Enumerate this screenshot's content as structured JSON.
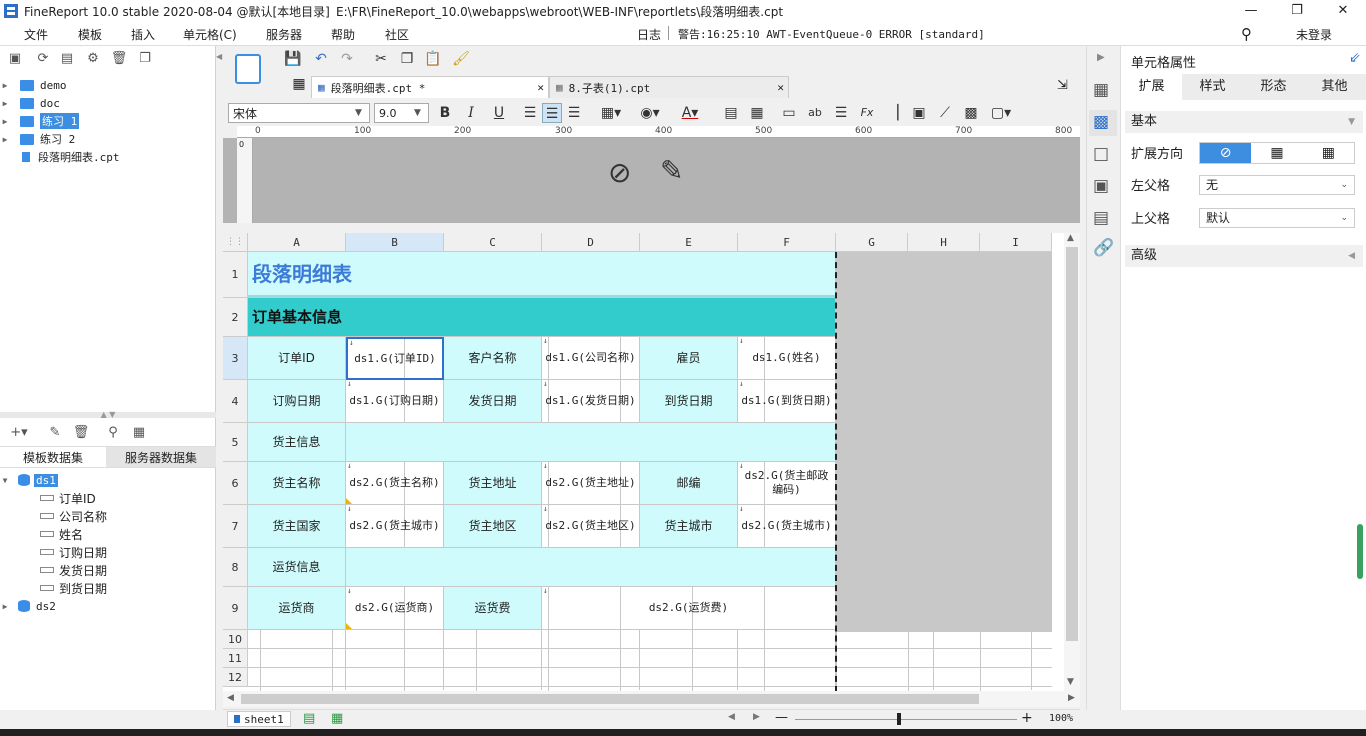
{
  "window": {
    "title": "FineReport 10.0 stable 2020-08-04 @默认[本地目录]",
    "path": "E:\\FR\\FineReport_10.0\\webapps\\webroot\\WEB-INF\\reportlets\\段落明细表.cpt"
  },
  "menu": {
    "items": [
      "文件",
      "模板",
      "插入",
      "单元格(C)",
      "服务器",
      "帮助",
      "社区"
    ],
    "log_label": "日志",
    "warning_text": "警告:16:25:10 AWT-EventQueue-0 ERROR [standard]",
    "login_label": "未登录"
  },
  "file_tree": {
    "items": [
      {
        "label": "demo",
        "type": "folder"
      },
      {
        "label": "doc",
        "type": "folder"
      },
      {
        "label": "练习 1",
        "type": "folder",
        "selected": true
      },
      {
        "label": "练习 2",
        "type": "folder"
      },
      {
        "label": "段落明细表.cpt",
        "type": "file"
      }
    ]
  },
  "dataset_panel": {
    "tabs": [
      "模板数据集",
      "服务器数据集"
    ],
    "datasets": [
      {
        "name": "ds1",
        "fields": [
          "订单ID",
          "公司名称",
          "姓名",
          "订购日期",
          "发货日期",
          "到货日期"
        ]
      },
      {
        "name": "ds2",
        "fields": []
      }
    ]
  },
  "editor_tabs": [
    {
      "label": "段落明细表.cpt *",
      "active": true
    },
    {
      "label": "8.子表(1).cpt",
      "active": false
    }
  ],
  "format_toolbar": {
    "font_name": "宋体",
    "font_size": "9.0",
    "bold": "B",
    "italic": "I",
    "underline": "U"
  },
  "ruler": {
    "ticks": [
      "0",
      "100",
      "200",
      "300",
      "400",
      "500",
      "600",
      "700",
      "800"
    ],
    "v_tick": "0"
  },
  "sheet": {
    "columns": [
      "A",
      "B",
      "C",
      "D",
      "E",
      "F",
      "G",
      "H",
      "I"
    ],
    "rows": [
      "1",
      "2",
      "3",
      "4",
      "5",
      "6",
      "7",
      "8",
      "9",
      "10",
      "11",
      "12"
    ],
    "title": "段落明细表",
    "section_header": "订单基本信息",
    "r3": [
      "订单ID",
      "ds1.G(订单ID)",
      "客户名称",
      "ds1.G(公司名称)",
      "雇员",
      "ds1.G(姓名)"
    ],
    "r4": [
      "订购日期",
      "ds1.G(订购日期)",
      "发货日期",
      "ds1.G(发货日期)",
      "到货日期",
      "ds1.G(到货日期)"
    ],
    "r5": [
      "货主信息"
    ],
    "r6": [
      "货主名称",
      "ds2.G(货主名称)",
      "货主地址",
      "ds2.G(货主地址)",
      "邮编",
      "ds2.G(货主邮政编码)"
    ],
    "r7": [
      "货主国家",
      "ds2.G(货主城市)",
      "货主地区",
      "ds2.G(货主地区)",
      "货主城市",
      "ds2.G(货主城市)"
    ],
    "r8": [
      "运货信息"
    ],
    "r9": [
      "运货商",
      "ds2.G(运货商)",
      "运货费",
      "ds2.G(运货费)"
    ]
  },
  "status": {
    "sheet_tab": "sheet1",
    "zoom": "100%"
  },
  "right_panel": {
    "title": "单元格属性",
    "tabs": [
      "扩展",
      "样式",
      "形态",
      "其他"
    ],
    "basic_section": "基本",
    "expand_direction_label": "扩展方向",
    "left_parent_label": "左父格",
    "left_parent_value": "无",
    "up_parent_label": "上父格",
    "up_parent_value": "默认",
    "advanced_section": "高级"
  },
  "colors": {
    "accent": "#3d8de0",
    "cell_cyan": "#cffbfc",
    "section_teal": "#33cccc",
    "title_blue": "#3d7bd9"
  }
}
